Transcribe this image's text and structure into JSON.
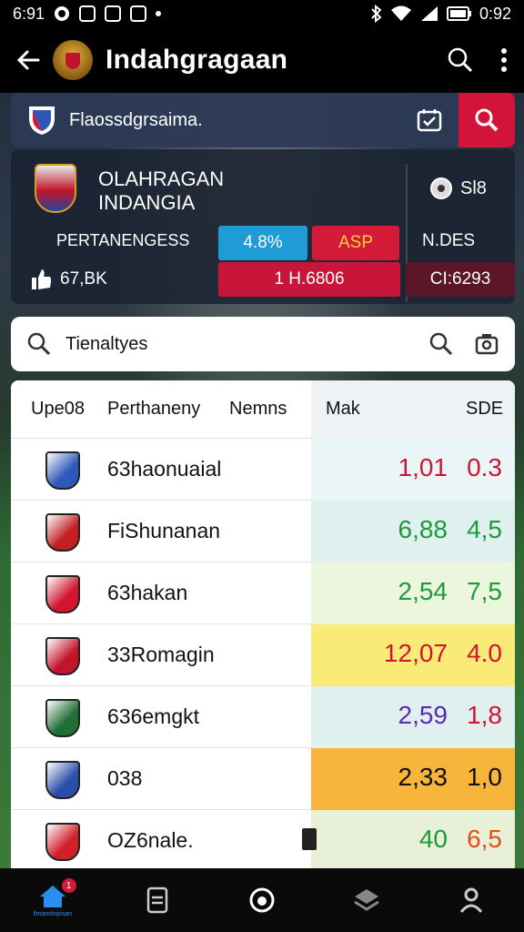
{
  "status_bar": {
    "time_left": "6:91",
    "time_right": "0:92"
  },
  "app_bar": {
    "title": "Indahgragaan"
  },
  "top_search": {
    "label": "Flaossdgrsaima."
  },
  "scorecard": {
    "team_name_line1": "OLAHRAGAN",
    "team_name_line2": "INDANGIA",
    "row_label": "PERTANENGESS",
    "pill_blue": "4.8%",
    "pill_red": "ASP",
    "side_top": "Sl8",
    "side_mid": "N.DES",
    "bottom_left": "67,BK",
    "pill_big": "1 H.6806",
    "pill_dark": "CI:6293"
  },
  "search": {
    "placeholder": "Tienaltyes"
  },
  "table": {
    "headers": [
      "Upe08",
      "Perthaneny",
      "Nemns",
      "Mak",
      "SDE"
    ],
    "rows": [
      {
        "name": "63haonuaial",
        "v1": "1,01",
        "v2": "0.3",
        "v1_color": "#d2142e",
        "v2_color": "#d2142e",
        "shade": "#eaf5f8"
      },
      {
        "name": "FiShunanan",
        "v1": "6,88",
        "v2": "4,5",
        "v1_color": "#1d9a3c",
        "v2_color": "#1d9a3c",
        "shade": "#dff0ee"
      },
      {
        "name": "63hakan",
        "v1": "2,54",
        "v2": "7,5",
        "v1_color": "#1d9a3c",
        "v2_color": "#1d9a3c",
        "shade": "#ecf6dc"
      },
      {
        "name": "33Romagin",
        "v1": "12,07",
        "v2": "4.0",
        "v1_color": "#d2142e",
        "v2_color": "#d2142e",
        "shade": "#faea78"
      },
      {
        "name": "636emgkt",
        "v1": "2,59",
        "v2": "1,8",
        "v1_color": "#5a2ab0",
        "v2_color": "#d2142e",
        "shade": "#dff0ee"
      },
      {
        "name": "038",
        "v1": "2,33",
        "v2": "1,0",
        "v1_color": "#111111",
        "v2_color": "#111111",
        "shade": "#f7b53c"
      },
      {
        "name": "OZ6nale.",
        "v1": "40",
        "v2": "6,5",
        "v1_color": "#1d9a3c",
        "v2_color": "#e0501c",
        "shade": "#e8f0d8"
      }
    ],
    "row_logos": [
      "#2d57b8",
      "#c21f22",
      "#d2142e",
      "#c2142a",
      "#1f6e36",
      "#2a4fa8",
      "#d0202a"
    ]
  },
  "bottom_nav": {
    "badge": "1",
    "home_label": "Ilmanshipisan"
  },
  "colors": {
    "accent_red": "#d3143a",
    "accent_blue": "#1f9bd6",
    "nav_active": "#2a8ef0"
  }
}
